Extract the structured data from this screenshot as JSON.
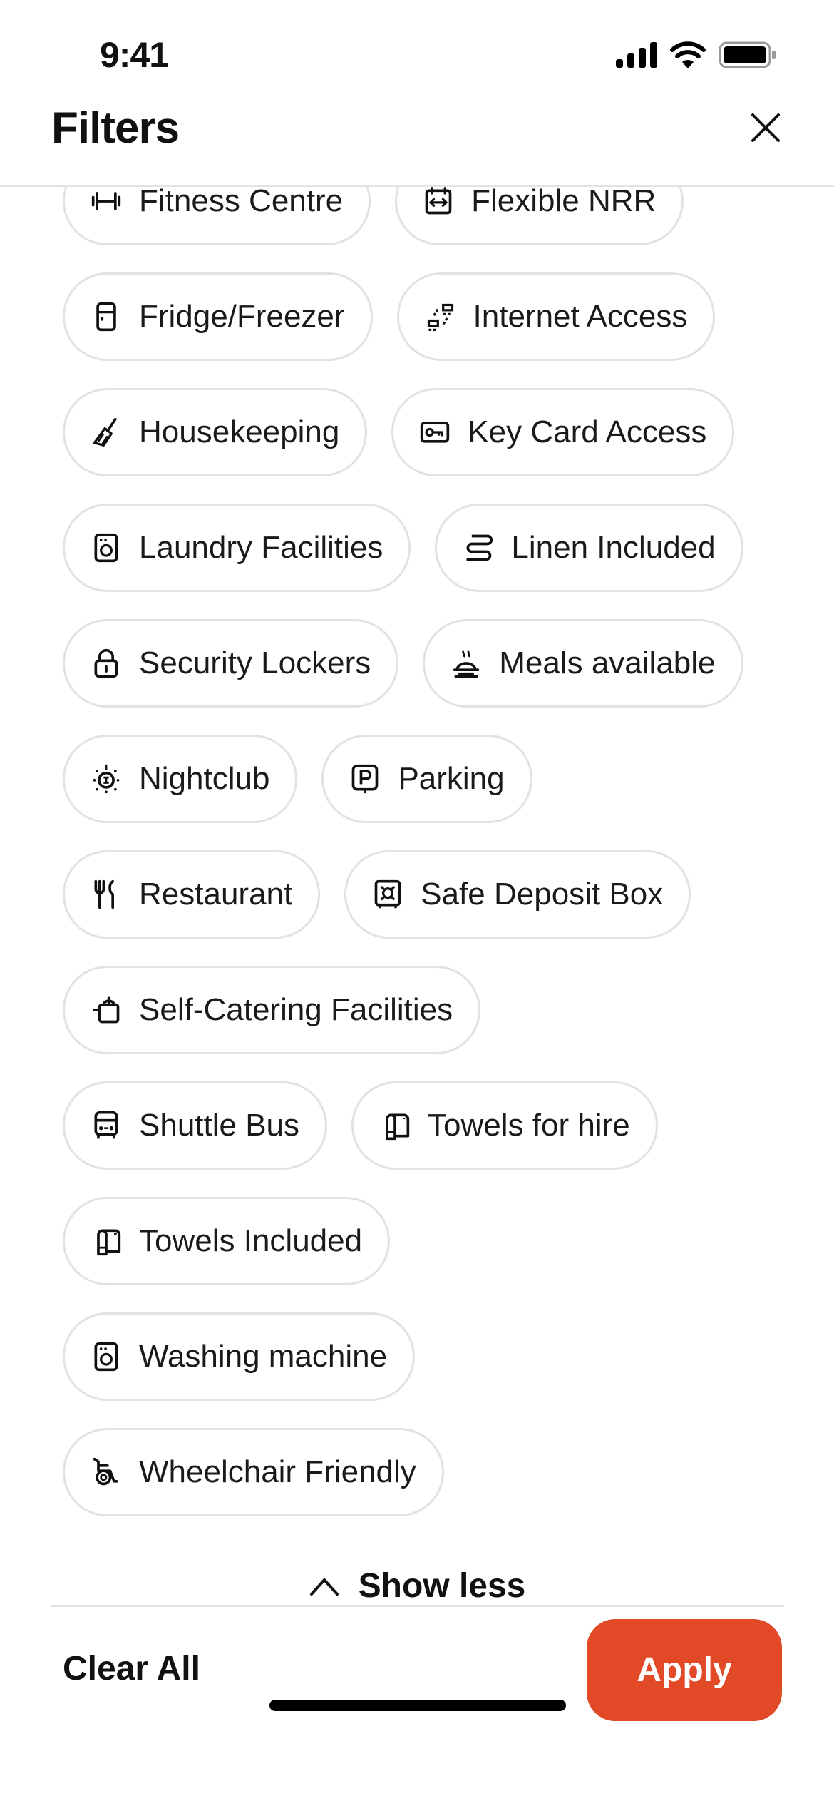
{
  "status_bar": {
    "time": "9:41"
  },
  "header": {
    "title": "Filters",
    "close_icon": "close-icon"
  },
  "facilities": [
    [
      {
        "label": "Fitness Centre",
        "icon": "dumbbell-icon"
      },
      {
        "label": "Flexible NRR",
        "icon": "calendar-arrows-icon"
      }
    ],
    [
      {
        "label": "Fridge/Freezer",
        "icon": "fridge-icon"
      },
      {
        "label": "Internet Access",
        "icon": "network-icon"
      }
    ],
    [
      {
        "label": "Housekeeping",
        "icon": "broom-icon"
      },
      {
        "label": "Key Card Access",
        "icon": "key-card-icon"
      }
    ],
    [
      {
        "label": "Laundry Facilities",
        "icon": "washing-machine-icon"
      },
      {
        "label": "Linen Included",
        "icon": "linen-icon"
      }
    ],
    [
      {
        "label": "Security Lockers",
        "icon": "lock-icon"
      },
      {
        "label": "Meals available",
        "icon": "meal-icon"
      }
    ],
    [
      {
        "label": "Nightclub",
        "icon": "disco-light-icon"
      },
      {
        "label": "Parking",
        "icon": "parking-icon"
      }
    ],
    [
      {
        "label": "Restaurant",
        "icon": "fork-knife-icon"
      },
      {
        "label": "Safe Deposit Box",
        "icon": "safe-icon"
      }
    ],
    [
      {
        "label": "Self-Catering Facilities",
        "icon": "cooking-pot-icon"
      }
    ],
    [
      {
        "label": "Shuttle Bus",
        "icon": "bus-icon"
      },
      {
        "label": "Towels for hire",
        "icon": "towel-icon"
      }
    ],
    [
      {
        "label": "Towels Included",
        "icon": "towel-icon"
      }
    ],
    [
      {
        "label": "Washing machine",
        "icon": "washing-machine-icon"
      }
    ],
    [
      {
        "label": "Wheelchair Friendly",
        "icon": "wheelchair-icon"
      }
    ]
  ],
  "show_less": {
    "label": "Show less"
  },
  "footer": {
    "clear_all": "Clear All",
    "apply": "Apply"
  },
  "colors": {
    "accent": "#e24a27",
    "chip_border": "#e2e2e5",
    "text": "#111111"
  }
}
